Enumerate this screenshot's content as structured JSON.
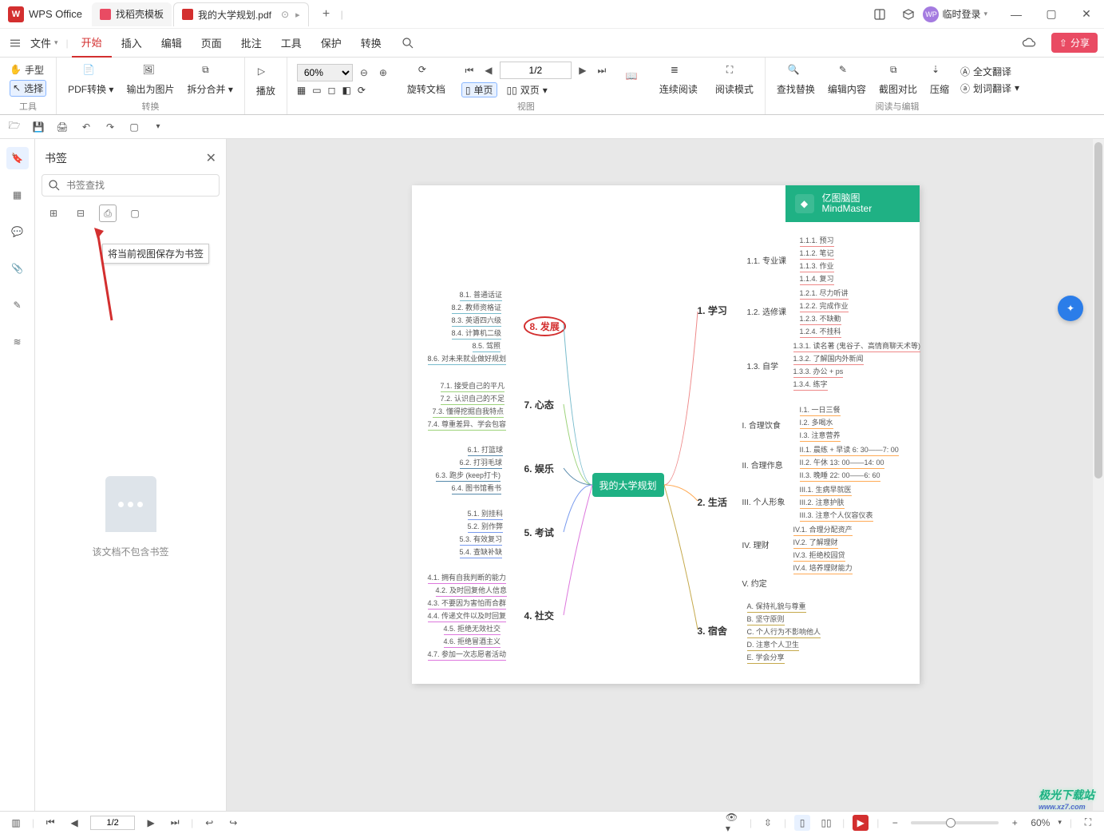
{
  "app": {
    "name": "WPS Office",
    "logo_letter": "W"
  },
  "tabs": [
    {
      "label": "找稻壳模板",
      "color": "#e94b63"
    },
    {
      "label": "我的大学规划.pdf",
      "color": "#d32f2f",
      "active": true
    }
  ],
  "titlebar": {
    "login": "临时登录",
    "avatar_letter": "WP"
  },
  "menubar": {
    "file": "文件",
    "items": [
      "开始",
      "插入",
      "编辑",
      "页面",
      "批注",
      "工具",
      "保护",
      "转换"
    ],
    "active": "开始",
    "share": "分享"
  },
  "ribbon": {
    "g1": {
      "hand": "手型",
      "select": "选择",
      "label": "工具"
    },
    "g2": {
      "pdfconv": "PDF转换",
      "exportimg": "输出为图片",
      "splitmerge": "拆分合并",
      "label": "转换"
    },
    "g3": {
      "play": "播放"
    },
    "g4": {
      "zoom": "60%",
      "rotate": "旋转文档",
      "page_current": "1/2",
      "single": "单页",
      "double": "双页",
      "continuous": "连续阅读",
      "readmode": "阅读模式",
      "label": "视图"
    },
    "g5": {
      "find": "查找替换",
      "edit": "编辑内容",
      "compare": "截图对比",
      "compress": "压缩",
      "fulltrans": "全文翻译",
      "wordtrans": "划词翻译",
      "label": "阅读与编辑"
    }
  },
  "sidepanel": {
    "title": "书签",
    "search_placeholder": "书签查找",
    "tooltip": "将当前视图保存为书签",
    "empty": "该文档不包含书签"
  },
  "doc": {
    "brand_cn": "亿图脑图",
    "brand_en": "MindMaster",
    "center": "我的大学规划",
    "l2": {
      "study": "1. 学习",
      "life": "2. 生活",
      "dorm": "3. 宿舍",
      "social": "4. 社交",
      "exam": "5. 考试",
      "fun": "6. 娱乐",
      "mind": "7. 心态",
      "dev": "8. 发展"
    },
    "l3_right": {
      "study": [
        "1.1. 专业课",
        "1.2. 选修课",
        "1.3. 自学"
      ],
      "life": [
        "I. 合理饮食",
        "II. 合理作息",
        "III. 个人形象",
        "IV. 理财",
        "V. 约定"
      ],
      "dorm": [
        "A. 保持礼貌与尊重",
        "B. 坚守原则",
        "C. 个人行为不影响他人",
        "D. 注意个人卫生",
        "E. 学会分享"
      ]
    },
    "l3_left": {
      "dev": [
        "8.1. 普通话证",
        "8.2. 教师资格证",
        "8.3. 英语四六级",
        "8.4. 计算机二级",
        "8.5. 驾照",
        "8.6. 对未来就业做好规划"
      ],
      "mind": [
        "7.1. 接受自己的平凡",
        "7.2. 认识自己的不足",
        "7.3. 懂得挖掘自我特点",
        "7.4. 尊重差异、学会包容"
      ],
      "fun": [
        "6.1. 打篮球",
        "6.2. 打羽毛球",
        "6.3. 跑步 (keep打卡)",
        "6.4. 图书馆看书"
      ],
      "exam": [
        "5.1. 别挂科",
        "5.2. 别作弊",
        "5.3. 有效复习",
        "5.4. 查缺补缺"
      ],
      "social": [
        "4.1. 拥有自我判断的能力",
        "4.2. 及时回复他人信息",
        "4.3. 不要因为害怕而合群",
        "4.4. 传递文件以及时回复",
        "4.5. 拒绝无效社交",
        "4.6. 拒绝冒酒主义",
        "4.7. 参加一次志愿者活动"
      ]
    },
    "l4": {
      "study_1": [
        "1.1.1. 预习",
        "1.1.2. 笔记",
        "1.1.3. 作业",
        "1.1.4. 复习"
      ],
      "study_2": [
        "1.2.1. 尽力听讲",
        "1.2.2. 完成作业",
        "1.2.3. 不缺勤",
        "1.2.4. 不挂科"
      ],
      "study_3": [
        "1.3.1. 读名著 (鬼谷子、高情商聊天术等)",
        "1.3.2. 了解国内外新闻",
        "1.3.3. 办公 + ps",
        "1.3.4. 练字"
      ],
      "life_1": [
        "I.1. 一日三餐",
        "I.2. 多喝水",
        "I.3. 注意营养"
      ],
      "life_2": [
        "II.1. 晨练 + 早读 6: 30——7: 00",
        "II.2. 午休 13: 00——14: 00",
        "II.3. 晚睡 22: 00——6: 60"
      ],
      "life_3": [
        "III.1. 生病早就医",
        "III.2. 注意护肤",
        "III.3. 注意个人仪容仪表"
      ],
      "life_4": [
        "IV.1. 合理分配资产",
        "IV.2. 了解理财",
        "IV.3. 拒绝校园贷",
        "IV.4. 培养理财能力"
      ]
    }
  },
  "statusbar": {
    "page": "1/2",
    "zoom": "60%"
  },
  "watermark": {
    "line1": "极光下载站",
    "line2": "www.xz7.com"
  }
}
